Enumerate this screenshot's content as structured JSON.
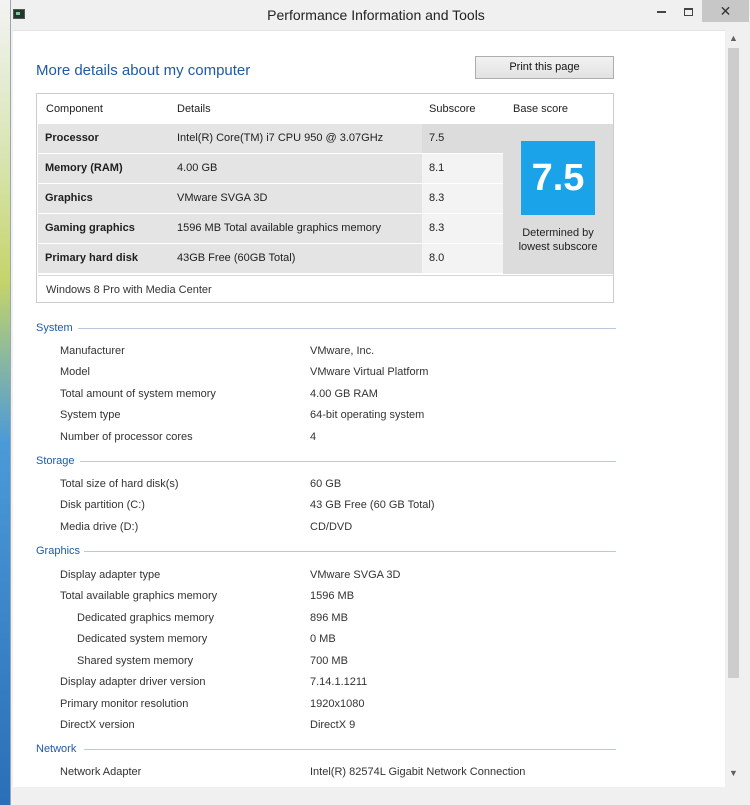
{
  "window": {
    "title": "Performance Information and Tools",
    "close_glyph": "✕"
  },
  "main": {
    "heading": "More details about my computer",
    "print_label": "Print this page"
  },
  "score_table": {
    "headers": {
      "component": "Component",
      "details": "Details",
      "subscore": "Subscore",
      "base": "Base score"
    },
    "rows": [
      {
        "name": "Processor",
        "detail": "Intel(R) Core(TM) i7 CPU 950 @ 3.07GHz",
        "subscore": "7.5"
      },
      {
        "name": "Memory (RAM)",
        "detail": "4.00 GB",
        "subscore": "8.1"
      },
      {
        "name": "Graphics",
        "detail": "VMware SVGA 3D",
        "subscore": "8.3"
      },
      {
        "name": "Gaming graphics",
        "detail": "1596 MB Total available graphics memory",
        "subscore": "8.3"
      },
      {
        "name": "Primary hard disk",
        "detail": "43GB Free (60GB Total)",
        "subscore": "8.0"
      }
    ],
    "base_score": "7.5",
    "base_caption_1": "Determined by",
    "base_caption_2": "lowest subscore",
    "base_color": "#1aa3e8",
    "edition": "Windows 8 Pro with Media Center"
  },
  "sections": {
    "system": {
      "title": "System",
      "rows": [
        {
          "label": "Manufacturer",
          "value": "VMware, Inc."
        },
        {
          "label": "Model",
          "value": "VMware Virtual Platform"
        },
        {
          "label": "Total amount of system memory",
          "value": "4.00 GB RAM"
        },
        {
          "label": "System type",
          "value": "64-bit operating system"
        },
        {
          "label": "Number of processor cores",
          "value": "4"
        }
      ]
    },
    "storage": {
      "title": "Storage",
      "rows": [
        {
          "label": "Total size of hard disk(s)",
          "value": "60 GB"
        },
        {
          "label": "Disk partition (C:)",
          "value": "43 GB Free (60 GB Total)"
        },
        {
          "label": "Media drive (D:)",
          "value": "CD/DVD"
        }
      ]
    },
    "graphics": {
      "title": "Graphics",
      "rows": [
        {
          "label": "Display adapter type",
          "value": "VMware SVGA 3D"
        },
        {
          "label": "Total available graphics memory",
          "value": "1596 MB"
        },
        {
          "label": "Dedicated graphics memory",
          "value": "896 MB"
        },
        {
          "label": "Dedicated system memory",
          "value": "0 MB"
        },
        {
          "label": "Shared system memory",
          "value": "700 MB"
        },
        {
          "label": "Display adapter driver version",
          "value": "7.14.1.1211"
        },
        {
          "label": "Primary monitor resolution",
          "value": "1920x1080"
        },
        {
          "label": "DirectX version",
          "value": "DirectX 9"
        }
      ]
    },
    "network": {
      "title": "Network",
      "rows": [
        {
          "label": "Network Adapter",
          "value": "Intel(R) 82574L Gigabit Network Connection"
        }
      ]
    }
  }
}
